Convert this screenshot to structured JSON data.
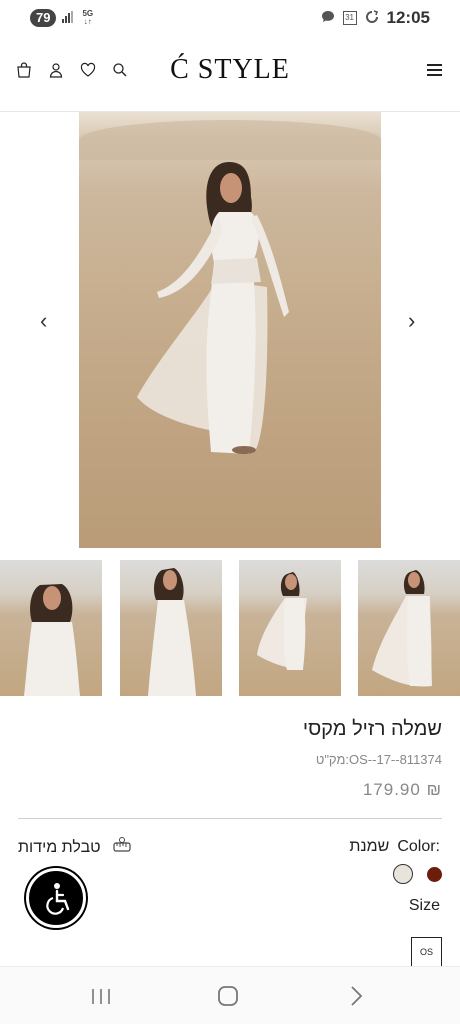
{
  "status_bar": {
    "battery": "79",
    "network": "5G",
    "calendar_day": "31",
    "time": "12:05"
  },
  "header": {
    "logo": "Ć STYLE",
    "icons": [
      "bag-icon",
      "user-icon",
      "heart-icon",
      "search-icon",
      "menu-icon"
    ]
  },
  "gallery": {
    "prev_arrow": "‹",
    "next_arrow": "›",
    "thumbnail_count": 4
  },
  "product": {
    "title": "שמלה רזיל מקסי",
    "sku": "מק\"ט:OS--17--811374",
    "price": "179.90 ₪"
  },
  "options": {
    "size_table_label": "טבלת מידות",
    "color_label": "Color:",
    "color_value": "שמנת",
    "colors": [
      "#e8e4dc",
      "#6b1e0a"
    ],
    "size_label": "Size",
    "sizes": [
      "OS"
    ]
  },
  "accessibility_button": "accessibility-icon",
  "nav_bar": {
    "buttons": [
      "recent-apps-icon",
      "home-icon",
      "back-icon"
    ]
  }
}
